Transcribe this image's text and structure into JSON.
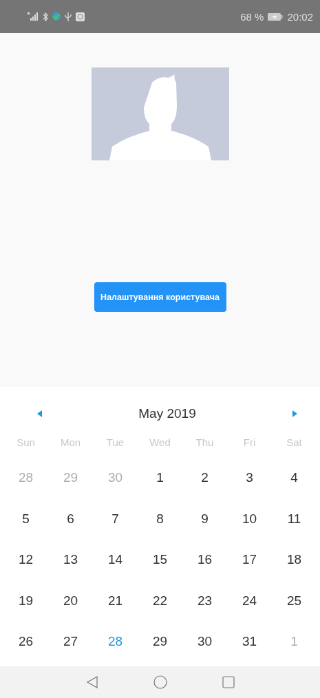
{
  "status_bar": {
    "battery": "68 %",
    "time": "20:02"
  },
  "profile": {
    "settings_button": "Налаштування користувача"
  },
  "calendar": {
    "month": "May 2019",
    "weekdays": [
      "Sun",
      "Mon",
      "Tue",
      "Wed",
      "Thu",
      "Fri",
      "Sat"
    ],
    "weeks": [
      [
        {
          "day": "28",
          "outside": true,
          "selected": false
        },
        {
          "day": "29",
          "outside": true,
          "selected": false
        },
        {
          "day": "30",
          "outside": true,
          "selected": false
        },
        {
          "day": "1",
          "outside": false,
          "selected": false
        },
        {
          "day": "2",
          "outside": false,
          "selected": false
        },
        {
          "day": "3",
          "outside": false,
          "selected": false
        },
        {
          "day": "4",
          "outside": false,
          "selected": false
        }
      ],
      [
        {
          "day": "5",
          "outside": false,
          "selected": false
        },
        {
          "day": "6",
          "outside": false,
          "selected": false
        },
        {
          "day": "7",
          "outside": false,
          "selected": false
        },
        {
          "day": "8",
          "outside": false,
          "selected": false
        },
        {
          "day": "9",
          "outside": false,
          "selected": false
        },
        {
          "day": "10",
          "outside": false,
          "selected": false
        },
        {
          "day": "11",
          "outside": false,
          "selected": false
        }
      ],
      [
        {
          "day": "12",
          "outside": false,
          "selected": false
        },
        {
          "day": "13",
          "outside": false,
          "selected": false
        },
        {
          "day": "14",
          "outside": false,
          "selected": false
        },
        {
          "day": "15",
          "outside": false,
          "selected": false
        },
        {
          "day": "16",
          "outside": false,
          "selected": false
        },
        {
          "day": "17",
          "outside": false,
          "selected": false
        },
        {
          "day": "18",
          "outside": false,
          "selected": false
        }
      ],
      [
        {
          "day": "19",
          "outside": false,
          "selected": false
        },
        {
          "day": "20",
          "outside": false,
          "selected": false
        },
        {
          "day": "21",
          "outside": false,
          "selected": false
        },
        {
          "day": "22",
          "outside": false,
          "selected": false
        },
        {
          "day": "23",
          "outside": false,
          "selected": false
        },
        {
          "day": "24",
          "outside": false,
          "selected": false
        },
        {
          "day": "25",
          "outside": false,
          "selected": false
        }
      ],
      [
        {
          "day": "26",
          "outside": false,
          "selected": false
        },
        {
          "day": "27",
          "outside": false,
          "selected": false
        },
        {
          "day": "28",
          "outside": false,
          "selected": true
        },
        {
          "day": "29",
          "outside": false,
          "selected": false
        },
        {
          "day": "30",
          "outside": false,
          "selected": false
        },
        {
          "day": "31",
          "outside": false,
          "selected": false
        },
        {
          "day": "1",
          "outside": true,
          "selected": false
        }
      ]
    ]
  }
}
